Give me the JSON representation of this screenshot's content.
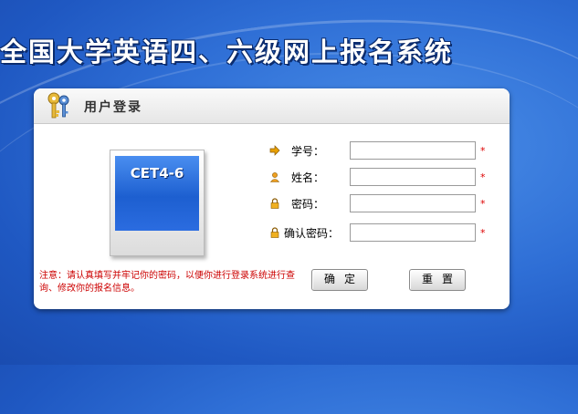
{
  "page": {
    "title": "全国大学英语四、六级网上报名系统"
  },
  "panel": {
    "title": "用户登录"
  },
  "logo": {
    "text": "CET4-6"
  },
  "form": {
    "fields": [
      {
        "label": "学号：",
        "icon": "arrow-icon",
        "value": "",
        "required_mark": "*"
      },
      {
        "label": "姓名：",
        "icon": "user-icon",
        "value": "",
        "required_mark": "*"
      },
      {
        "label": "密码：",
        "icon": "lock-icon",
        "value": "",
        "required_mark": "*"
      },
      {
        "label": "确认密码：",
        "icon": "lock-icon",
        "value": "",
        "required_mark": "*"
      }
    ]
  },
  "notice": {
    "text": "注意：请认真填写并牢记你的密码，以便你进行登录系统进行查询、修改你的报名信息。"
  },
  "buttons": {
    "confirm": "确定",
    "reset": "重置"
  },
  "colors": {
    "background": "#2f6fd6",
    "notice": "#cc0000",
    "required": "#dd0000"
  }
}
